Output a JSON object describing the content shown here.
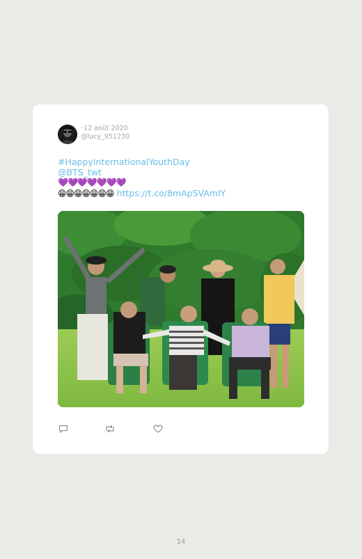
{
  "tweet": {
    "date": "12 août 2020",
    "handle": "@lucy_951230",
    "hashtag": "#HappyInternationalYouthDay",
    "mention": "@BTS_twt",
    "hearts": "💜💜💜💜💜💜💜",
    "laughs": "😁😁😁😁😁😁😁",
    "url": "https://t.co/8mApSVAmIY",
    "link_color": "#69bde8"
  },
  "actions": {
    "icons": [
      "reply-icon",
      "retweet-icon",
      "like-icon"
    ]
  },
  "page": {
    "number": "14"
  }
}
